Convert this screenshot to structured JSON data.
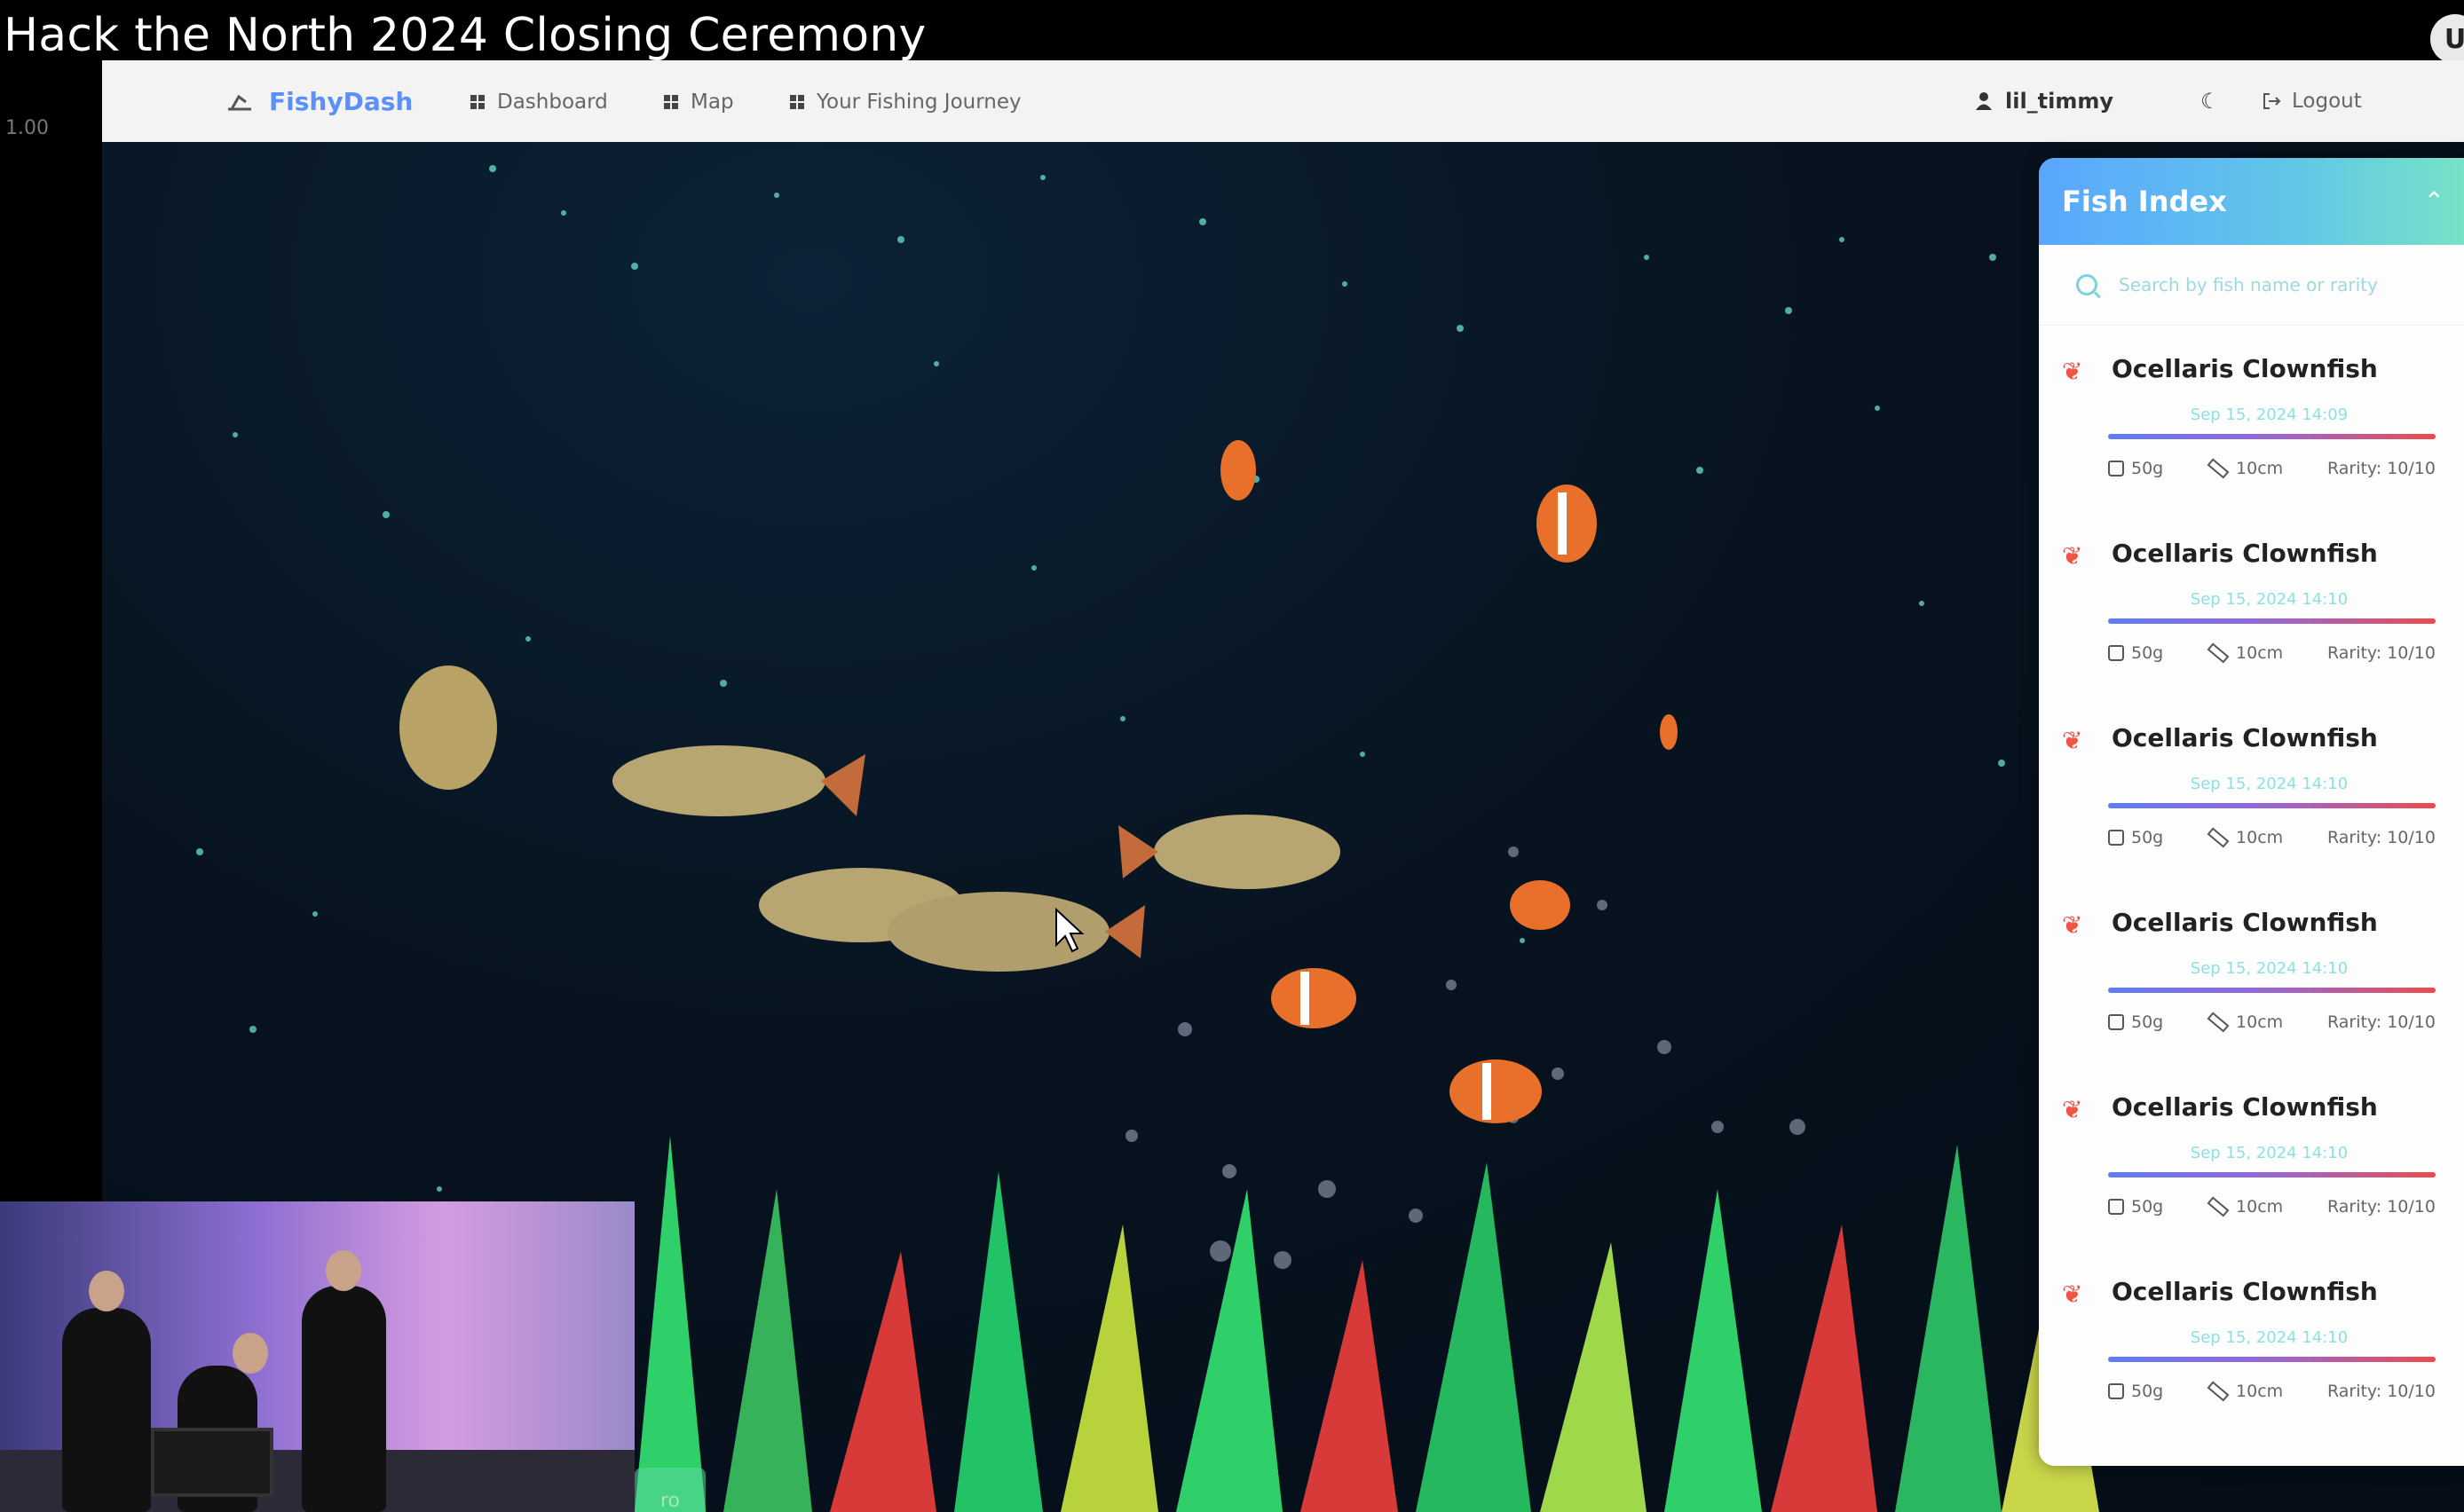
{
  "video": {
    "title": "Hack the North 2024 Closing Ceremony",
    "speed": "1.00",
    "corner_avatar": "U"
  },
  "navbar": {
    "brand": "FishyDash",
    "items": [
      {
        "label": "Dashboard",
        "icon": "grid-icon"
      },
      {
        "label": "Map",
        "icon": "grid-icon"
      },
      {
        "label": "Your Fishing Journey",
        "icon": "grid-icon"
      }
    ],
    "username": "lil_timmy",
    "logout_label": "Logout",
    "theme_icon": "moon-icon"
  },
  "fish_index": {
    "title": "Fish Index",
    "search_placeholder": "Search by fish name or rarity",
    "items": [
      {
        "name": "Ocellaris Clownfish",
        "date": "Sep 15, 2024 14:09",
        "weight": "50g",
        "length": "10cm",
        "rarity": "Rarity: 10/10"
      },
      {
        "name": "Ocellaris Clownfish",
        "date": "Sep 15, 2024 14:10",
        "weight": "50g",
        "length": "10cm",
        "rarity": "Rarity: 10/10"
      },
      {
        "name": "Ocellaris Clownfish",
        "date": "Sep 15, 2024 14:10",
        "weight": "50g",
        "length": "10cm",
        "rarity": "Rarity: 10/10"
      },
      {
        "name": "Ocellaris Clownfish",
        "date": "Sep 15, 2024 14:10",
        "weight": "50g",
        "length": "10cm",
        "rarity": "Rarity: 10/10"
      },
      {
        "name": "Ocellaris Clownfish",
        "date": "Sep 15, 2024 14:10",
        "weight": "50g",
        "length": "10cm",
        "rarity": "Rarity: 10/10"
      },
      {
        "name": "Ocellaris Clownfish",
        "date": "Sep 15, 2024 14:10",
        "weight": "50g",
        "length": "10cm",
        "rarity": "Rarity: 10/10"
      }
    ]
  },
  "partial_button": "ro",
  "colors": {
    "brand": "#5b8ff9",
    "panel_header_start": "#5aa6ff",
    "panel_header_end": "#77e2c7",
    "rarity_bar_end": "#ee4a4a"
  }
}
